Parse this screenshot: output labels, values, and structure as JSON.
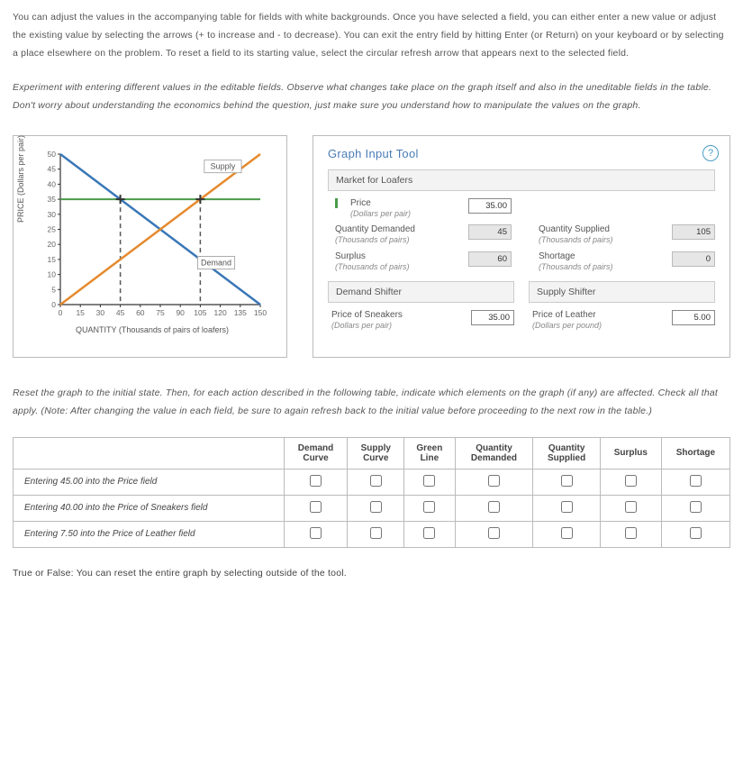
{
  "instructions": {
    "p1": "You can adjust the values in the accompanying table for fields with white backgrounds. Once you have selected a field, you can either enter a new value or adjust the existing value by selecting the arrows (+ to increase and - to decrease). You can exit the entry field by hitting Enter (or Return) on your keyboard or by selecting a place elsewhere on the problem. To reset a field to its starting value, select the circular refresh arrow that appears next to the selected field.",
    "p2": "Experiment with entering different values in the editable fields. Observe what changes take place on the graph itself and also in the uneditable fields in the table. Don't worry about understanding the economics behind the question, just make sure you understand how to manipulate the values on the graph."
  },
  "chart": {
    "ylabel": "PRICE (Dollars per pair)",
    "xlabel": "QUANTITY (Thousands of pairs of loafers)",
    "supply_label": "Supply",
    "demand_label": "Demand"
  },
  "panel": {
    "title": "Graph Input Tool",
    "market_header": "Market for Loafers",
    "demand_shifter_header": "Demand Shifter",
    "supply_shifter_header": "Supply Shifter",
    "fields": {
      "price": {
        "label": "Price",
        "sub": "(Dollars per pair)",
        "value": "35.00"
      },
      "qd": {
        "label": "Quantity Demanded",
        "sub": "(Thousands of pairs)",
        "value": "45"
      },
      "qs": {
        "label": "Quantity Supplied",
        "sub": "(Thousands of pairs)",
        "value": "105"
      },
      "surplus": {
        "label": "Surplus",
        "sub": "(Thousands of pairs)",
        "value": "60"
      },
      "shortage": {
        "label": "Shortage",
        "sub": "(Thousands of pairs)",
        "value": "0"
      },
      "sneakers": {
        "label": "Price of Sneakers",
        "sub": "(Dollars per pair)",
        "value": "35.00"
      },
      "leather": {
        "label": "Price of Leather",
        "sub": "(Dollars per pound)",
        "value": "5.00"
      }
    },
    "help": "?"
  },
  "question": {
    "prompt": "Reset the graph to the initial state. Then, for each action described in the following table, indicate which elements on the graph (if any) are affected. Check all that apply. (Note: After changing the value in each field, be sure to again refresh back to the initial value before proceeding to the next row in the table.)",
    "columns": [
      "Demand Curve",
      "Supply Curve",
      "Green Line",
      "Quantity Demanded",
      "Quantity Supplied",
      "Surplus",
      "Shortage"
    ],
    "rows": [
      "Entering 45.00 into the Price field",
      "Entering 40.00 into the Price of Sneakers field",
      "Entering 7.50 into the Price of Leather field"
    ]
  },
  "truefalse": "True or False: You can reset the entire graph by selecting outside of the tool.",
  "chart_data": {
    "type": "line",
    "xlim": [
      0,
      150
    ],
    "ylim": [
      0,
      50
    ],
    "x_ticks": [
      0,
      15,
      30,
      45,
      60,
      75,
      90,
      105,
      120,
      135,
      150
    ],
    "y_ticks": [
      0,
      5,
      10,
      15,
      20,
      25,
      30,
      35,
      40,
      45,
      50
    ],
    "series": [
      {
        "name": "Demand",
        "color": "#3a77b7",
        "x": [
          0,
          150
        ],
        "y": [
          50,
          0
        ]
      },
      {
        "name": "Supply",
        "color": "#e58a2e",
        "x": [
          0,
          150
        ],
        "y": [
          0,
          50
        ]
      }
    ],
    "h_line": {
      "y": 35,
      "color": "#4a9b4a"
    },
    "v_dash": [
      {
        "x": 45
      },
      {
        "x": 105
      }
    ],
    "markers": [
      {
        "x": 45,
        "y": 35
      },
      {
        "x": 105,
        "y": 35
      }
    ]
  }
}
